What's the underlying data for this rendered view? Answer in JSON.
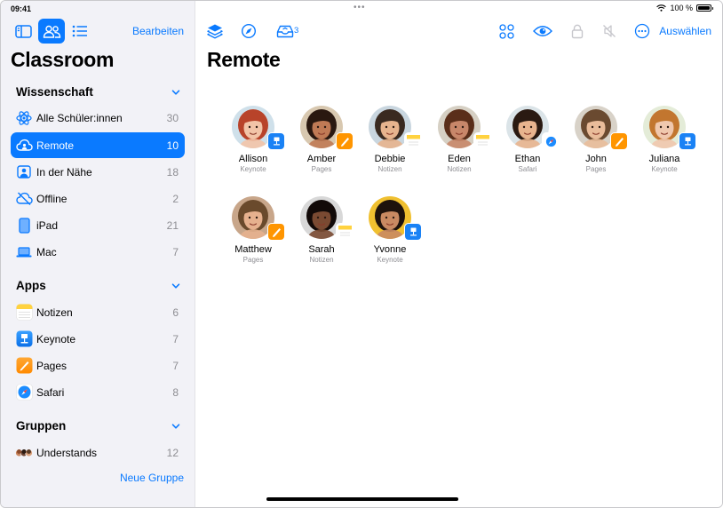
{
  "status": {
    "time": "09:41",
    "dots": "•••",
    "battery": "100 %"
  },
  "sidebar": {
    "edit_label": "Bearbeiten",
    "title": "Classroom",
    "sections": {
      "science": {
        "title": "Wissenschaft",
        "items": [
          {
            "label": "Alle Schüler:innen",
            "count": "30",
            "icon": "atom-icon"
          },
          {
            "label": "Remote",
            "count": "10",
            "icon": "cloud-icon",
            "selected": true
          },
          {
            "label": "In der Nähe",
            "count": "18",
            "icon": "person-rect-icon"
          },
          {
            "label": "Offline",
            "count": "2",
            "icon": "cloud-slash-icon"
          },
          {
            "label": "iPad",
            "count": "21",
            "icon": "ipad-icon"
          },
          {
            "label": "Mac",
            "count": "7",
            "icon": "laptop-icon"
          }
        ]
      },
      "apps": {
        "title": "Apps",
        "items": [
          {
            "label": "Notizen",
            "count": "6",
            "icon": "notes-app-icon"
          },
          {
            "label": "Keynote",
            "count": "7",
            "icon": "keynote-app-icon"
          },
          {
            "label": "Pages",
            "count": "7",
            "icon": "pages-app-icon"
          },
          {
            "label": "Safari",
            "count": "8",
            "icon": "safari-app-icon"
          }
        ]
      },
      "groups": {
        "title": "Gruppen",
        "items": [
          {
            "label": "Understands",
            "count": "12",
            "icon": "group-avatars-icon"
          }
        ]
      }
    },
    "new_group_label": "Neue Gruppe"
  },
  "main": {
    "title": "Remote",
    "inbox_count": "3",
    "select_label": "Auswählen",
    "students": [
      {
        "name": "Allison",
        "app": "Keynote"
      },
      {
        "name": "Amber",
        "app": "Pages"
      },
      {
        "name": "Debbie",
        "app": "Notizen"
      },
      {
        "name": "Eden",
        "app": "Notizen"
      },
      {
        "name": "Ethan",
        "app": "Safari"
      },
      {
        "name": "John",
        "app": "Pages"
      },
      {
        "name": "Juliana",
        "app": "Keynote"
      },
      {
        "name": "Matthew",
        "app": "Pages"
      },
      {
        "name": "Sarah",
        "app": "Notizen"
      },
      {
        "name": "Yvonne",
        "app": "Keynote"
      }
    ]
  },
  "colors": {
    "accent": "#0a7aff",
    "sidebar_bg": "#f2f2f7",
    "secondary_text": "#8e8e93"
  }
}
